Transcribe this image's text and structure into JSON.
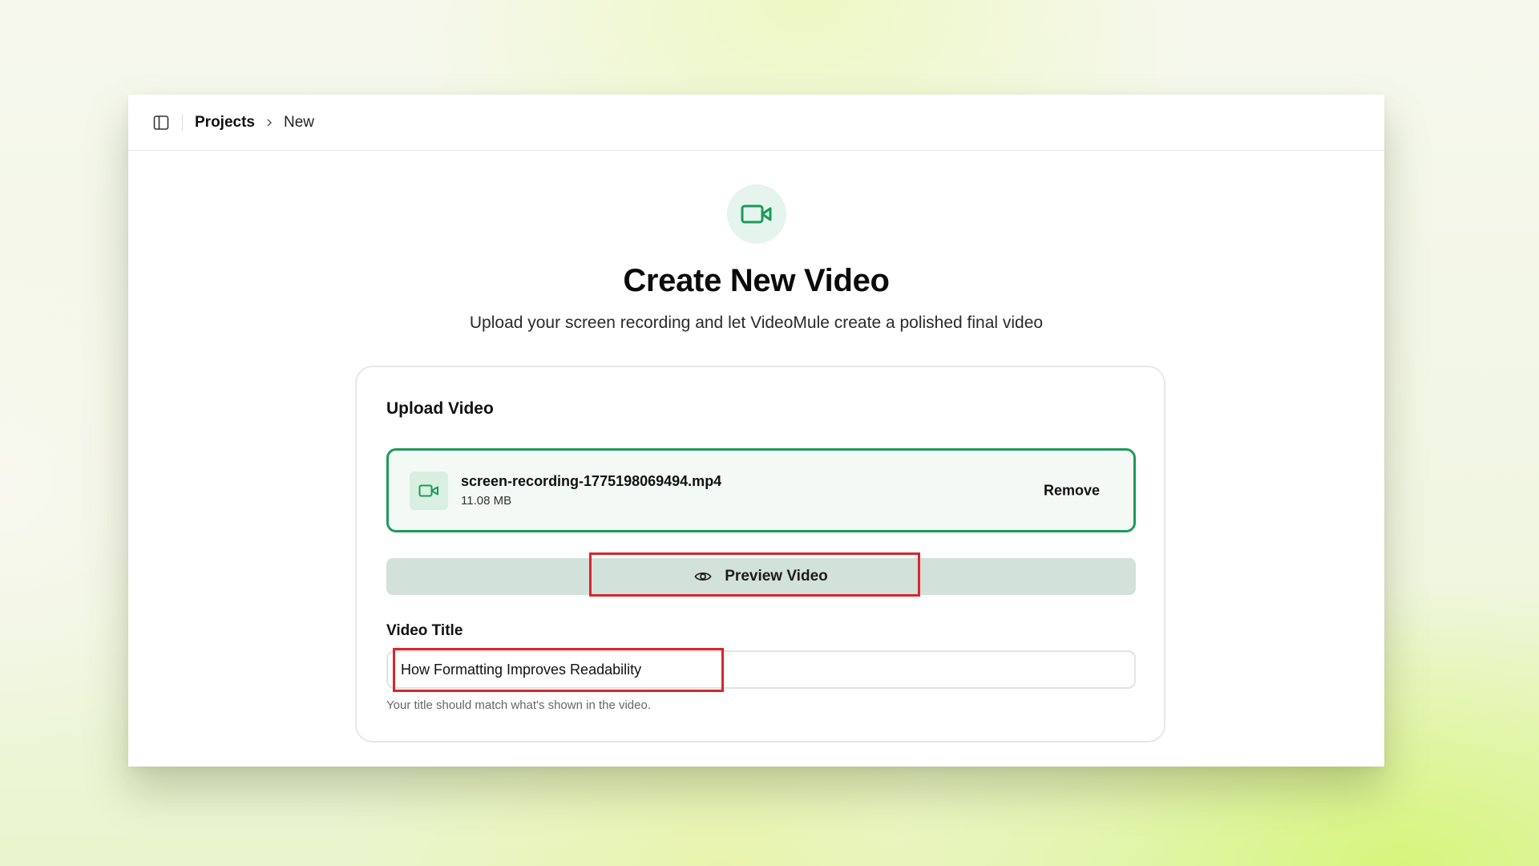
{
  "breadcrumb": {
    "root": "Projects",
    "current": "New"
  },
  "hero": {
    "icon": "video-camera-icon",
    "title": "Create New Video",
    "subtitle": "Upload your screen recording and let VideoMule create a polished final video"
  },
  "upload": {
    "section_title": "Upload Video",
    "file": {
      "icon": "video-camera-icon",
      "name": "screen-recording-1775198069494.mp4",
      "size": "11.08 MB",
      "remove_label": "Remove"
    },
    "preview_label": "Preview Video",
    "preview_icon": "eye-icon"
  },
  "title_field": {
    "label": "Video Title",
    "value": "How Formatting Improves Readability",
    "help": "Your title should match what's shown in the video."
  },
  "colors": {
    "accent": "#1e9a58",
    "highlight": "#d9262c",
    "preview_bg": "#d2e1d9"
  }
}
